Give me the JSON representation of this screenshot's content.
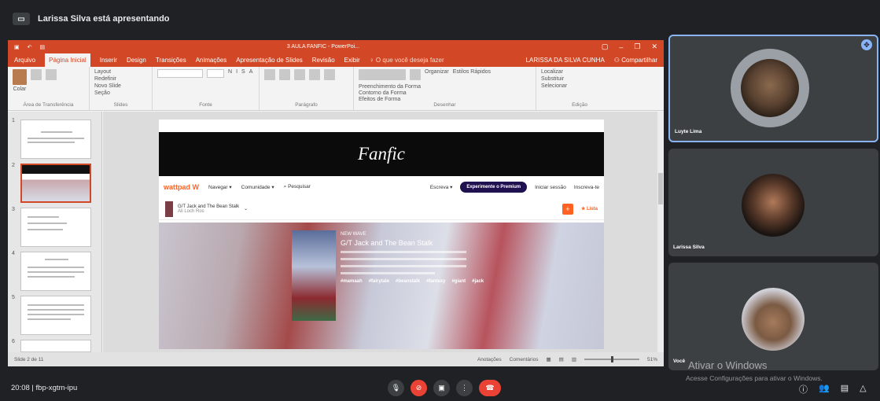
{
  "meeting": {
    "presenter_banner": "Larissa Silva está apresentando",
    "time": "20:08",
    "separator": "|",
    "meeting_code": "fbp-xgtm-ipu"
  },
  "powerpoint": {
    "window_title": "3 AULA FANFIC - PowerPoi...",
    "tabs": [
      "Arquivo",
      "Página Inicial",
      "Inserir",
      "Design",
      "Transições",
      "Animações",
      "Apresentação de Slides",
      "Revisão",
      "Exibir"
    ],
    "tell_me": "O que você deseja fazer",
    "user_name": "LARISSA DA SILVA CUNHA",
    "share": "Compartilhar",
    "ribbon": {
      "clipboard": {
        "paste": "Colar",
        "group": "Área de Transferência"
      },
      "slides": {
        "new_slide": "Novo Slide",
        "layout": "Layout",
        "reset": "Redefinir",
        "section": "Seção",
        "group": "Slides"
      },
      "font": {
        "group": "Fonte"
      },
      "paragraph": {
        "group": "Parágrafo"
      },
      "drawing": {
        "arrange": "Organizar",
        "quick_styles": "Estilos Rápidos",
        "fill": "Preenchimento da Forma",
        "outline": "Contorno da Forma",
        "effects": "Efeitos de Forma",
        "group": "Desenhar"
      },
      "editing": {
        "find": "Localizar",
        "replace": "Substituir",
        "select": "Selecionar",
        "group": "Edição"
      }
    },
    "thumbnail_numbers": [
      "1",
      "2",
      "3",
      "4",
      "5",
      "6"
    ],
    "status": {
      "slide_count": "Slide 2 de 11",
      "notes": "Anotações",
      "comments": "Comentários",
      "zoom": "51%"
    }
  },
  "slide": {
    "title": "Fanfic",
    "wattpad": {
      "logo": "wattpad",
      "navegar": "Navegar",
      "comunidade": "Comunidade",
      "search": "Pesquisar",
      "escreva": "Escreva",
      "premium": "Experimente o Premium",
      "login": "Iniciar sessão",
      "signup": "Inscreva-te",
      "story_title": "G/T Jack and The Bean Stalk",
      "story_author": "Ali Loch Ros",
      "add": "+",
      "lista": "Lista",
      "hero_label": "NEW WAVE",
      "hero_title": "G/T Jack and The Bean Stalk",
      "hero_tags": [
        "#mamaah",
        "#fairytale",
        "#beanstalk",
        "#fantasy",
        "#giant",
        "#jack"
      ]
    }
  },
  "participants": [
    {
      "name": "Luyte Lima"
    },
    {
      "name": "Larissa Silva"
    },
    {
      "name": "Você"
    }
  ],
  "windows_watermark": {
    "title": "Ativar o Windows",
    "subtitle": "Acesse Configurações para ativar o Windows."
  },
  "icons": {
    "pin": "pin-icon",
    "mic": "mic-icon",
    "camera_off": "camera-off-icon",
    "present": "present-screen-icon",
    "more": "more-vert-icon",
    "end_call": "end-call-icon",
    "info": "info-icon",
    "people": "people-icon",
    "chat": "chat-icon",
    "activities": "activities-icon"
  },
  "colors": {
    "ppt_accent": "#d24726",
    "meet_bg": "#202124",
    "tile_bg": "#3c4043",
    "end_red": "#ea4335",
    "active_border": "#8ab4f8",
    "wattpad_orange": "#ff6122"
  }
}
